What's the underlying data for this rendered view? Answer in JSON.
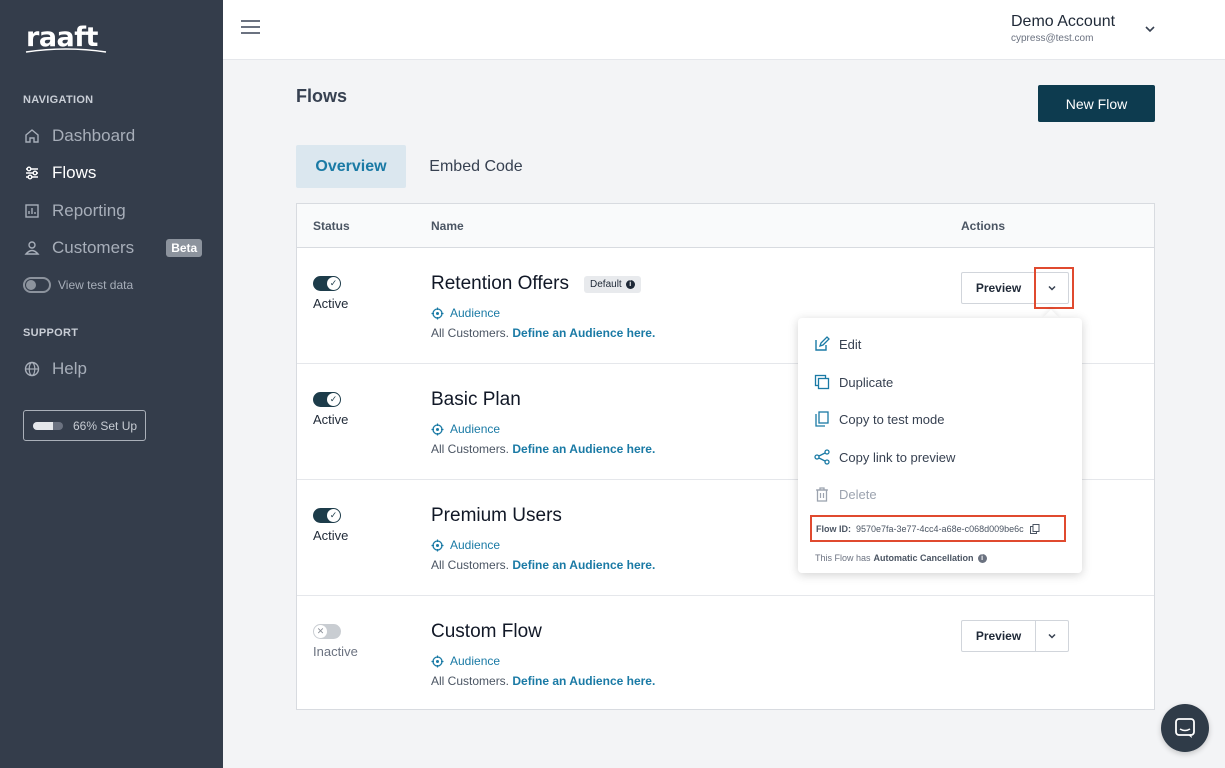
{
  "brand": {
    "logo_text": "raaft"
  },
  "sidebar": {
    "nav_label": "NAVIGATION",
    "items": [
      {
        "label": "Dashboard",
        "icon": "home-icon"
      },
      {
        "label": "Flows",
        "icon": "flows-icon",
        "active": true
      },
      {
        "label": "Reporting",
        "icon": "reporting-icon"
      },
      {
        "label": "Customers",
        "icon": "user-icon",
        "badge": "Beta"
      }
    ],
    "test_data_label": "View test data",
    "support_label": "SUPPORT",
    "help_label": "Help",
    "setup": {
      "label": "66% Set Up",
      "progress": 0.66
    }
  },
  "topbar": {
    "account_name": "Demo Account",
    "account_email": "cypress@test.com"
  },
  "page": {
    "title": "Flows",
    "new_flow_label": "New Flow",
    "tabs": [
      "Overview",
      "Embed Code"
    ]
  },
  "table": {
    "headers": {
      "status": "Status",
      "name": "Name",
      "actions": "Actions"
    },
    "audience_label": "Audience",
    "audience_prefix": "All Customers.",
    "audience_link": "Define an Audience here.",
    "preview_label": "Preview",
    "rows": [
      {
        "status": "Active",
        "name": "Retention Offers",
        "badge": "Default"
      },
      {
        "status": "Active",
        "name": "Basic Plan"
      },
      {
        "status": "Active",
        "name": "Premium Users"
      },
      {
        "status": "Inactive",
        "name": "Custom Flow"
      }
    ]
  },
  "menu": {
    "items": [
      "Edit",
      "Duplicate",
      "Copy to test mode",
      "Copy link to preview",
      "Delete"
    ],
    "flow_id_label": "Flow ID:",
    "flow_id_value": "9570e7fa-3e77-4cc4-a68e-c068d009be6c",
    "cancel_note_prefix": "This Flow has",
    "cancel_note_bold": "Automatic Cancellation"
  },
  "colors": {
    "sidebar_bg": "#343d4b",
    "accent": "#1a7aa5",
    "primary_button": "#0d3b4f",
    "highlight": "#e04a2f"
  }
}
